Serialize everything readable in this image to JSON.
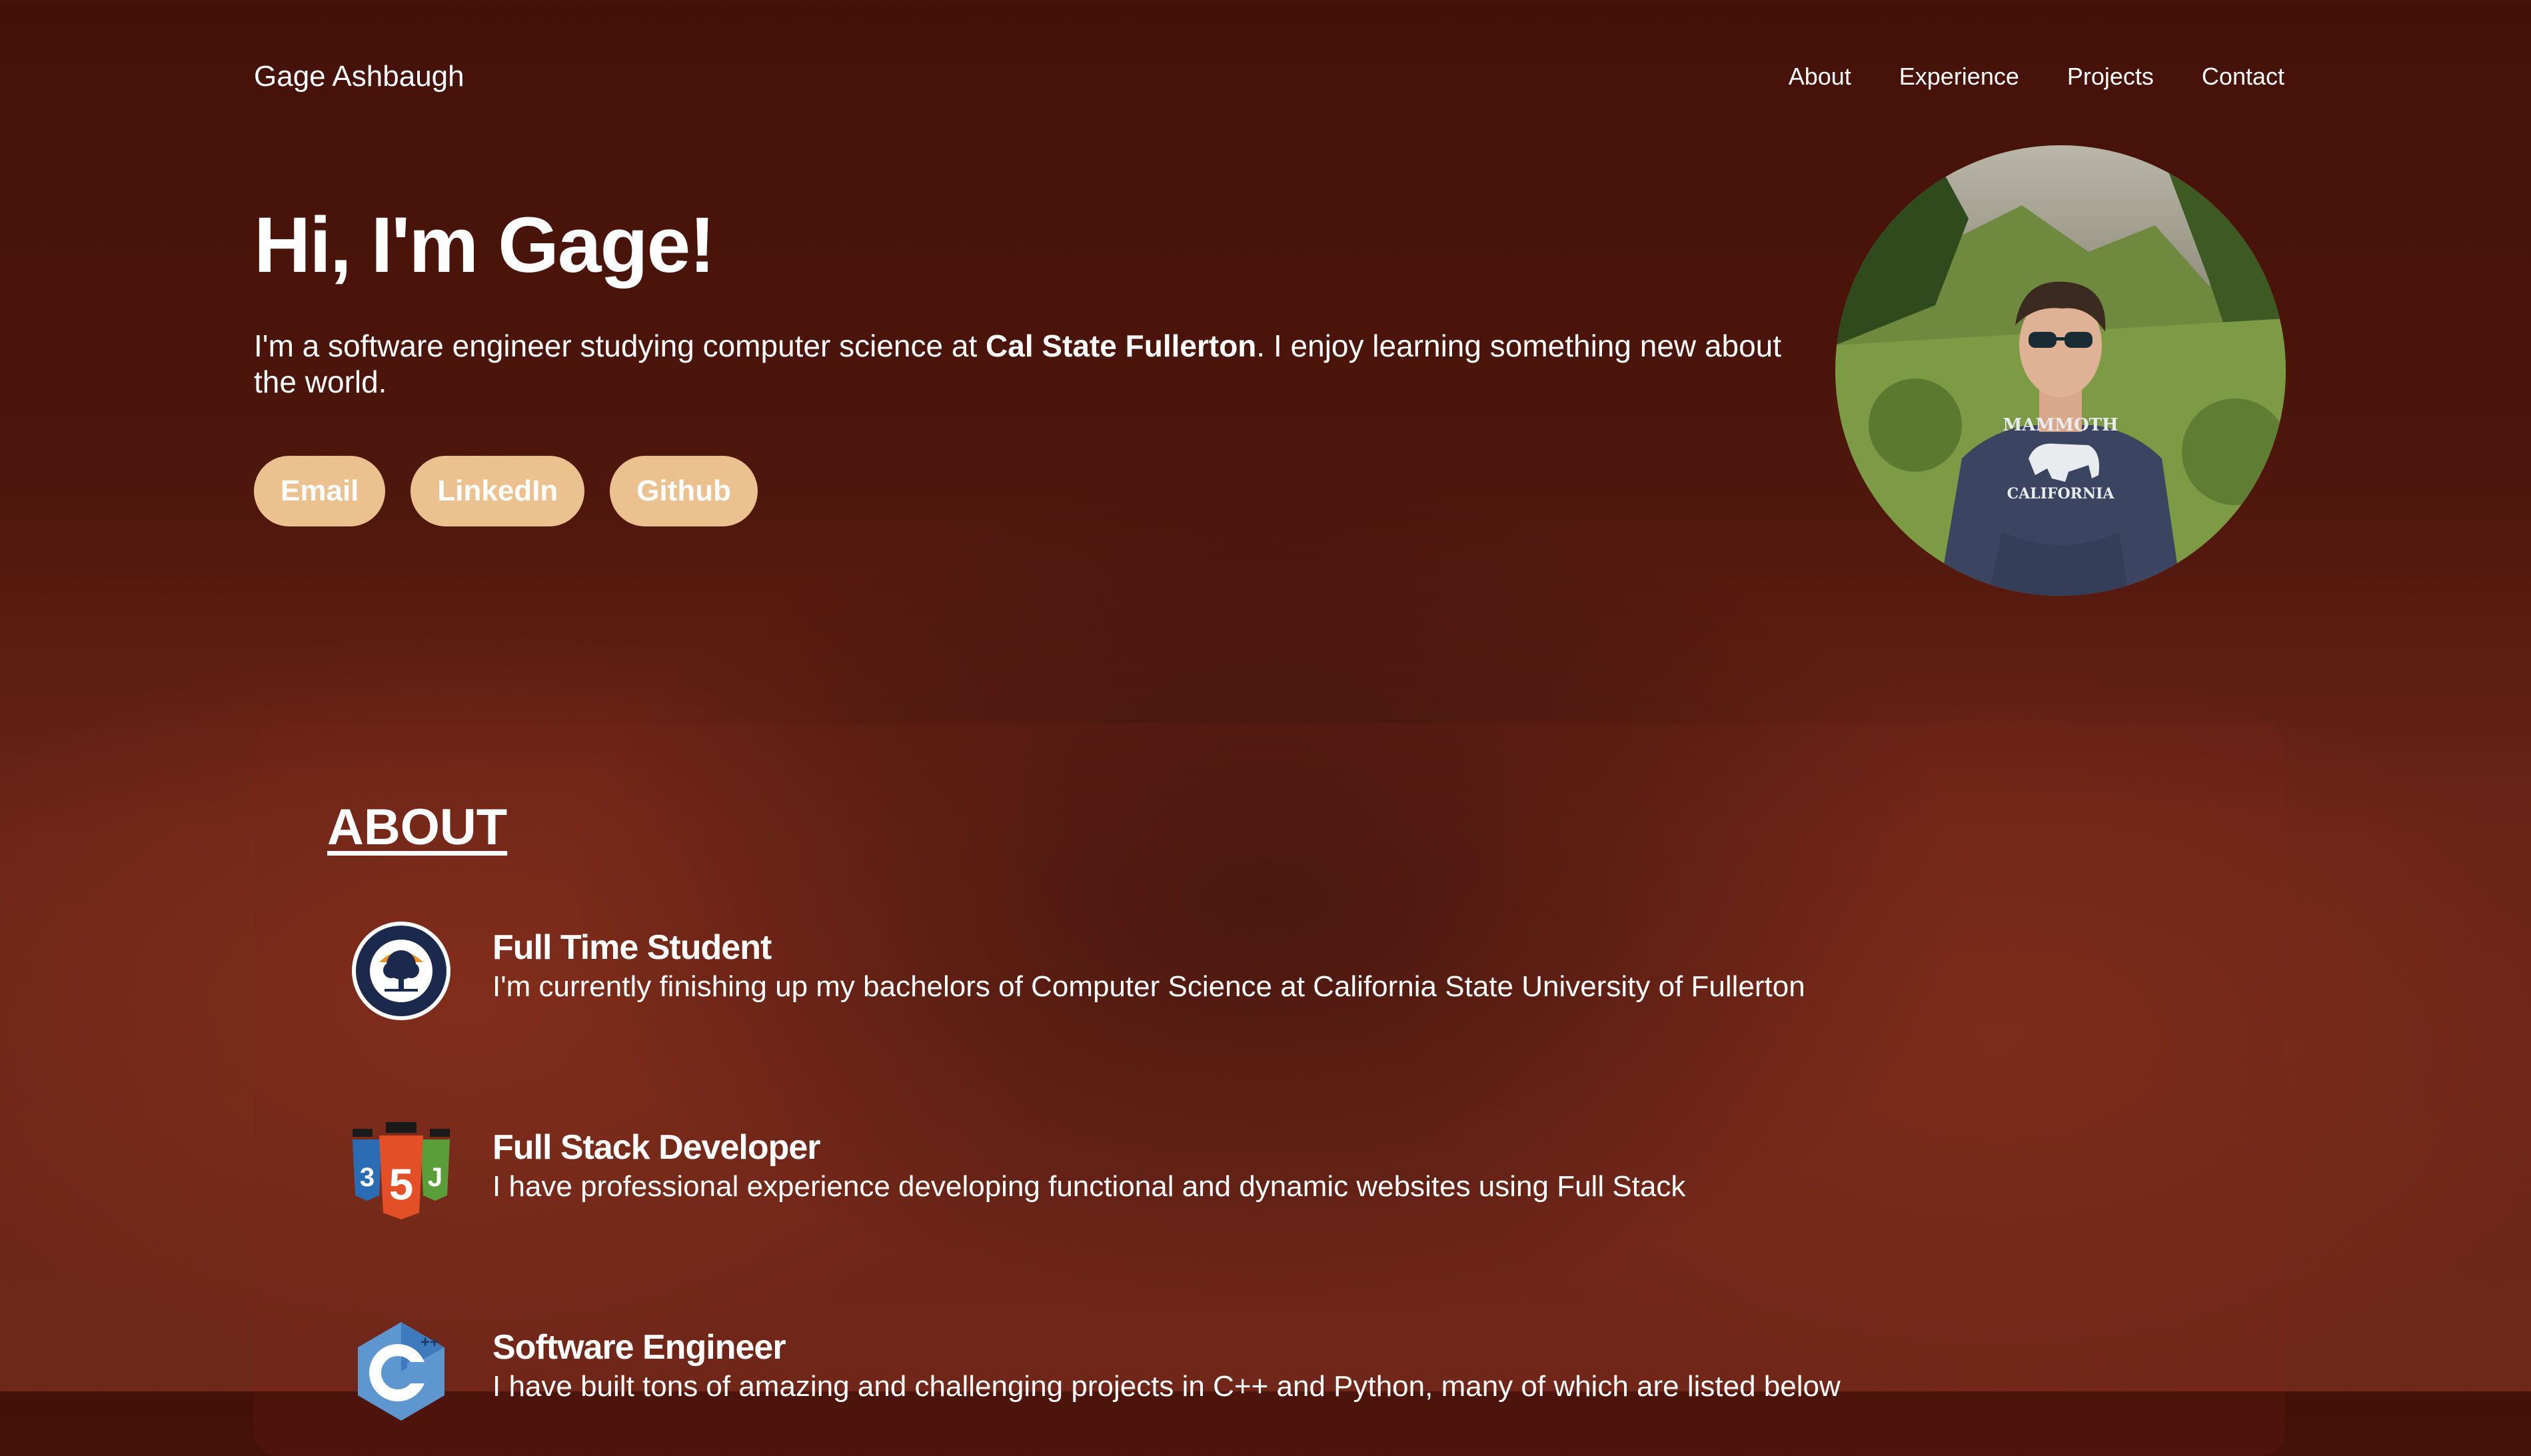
{
  "header": {
    "name": "Gage Ashbaugh",
    "nav": [
      "About",
      "Experience",
      "Projects",
      "Contact"
    ]
  },
  "hero": {
    "title": "Hi, I'm Gage!",
    "intro_before": "I'm a software engineer studying computer science at ",
    "intro_bold": "Cal State Fullerton",
    "intro_after": ". I enjoy learning something new about the world.",
    "buttons": [
      "Email",
      "LinkedIn",
      "Github"
    ],
    "photo_icon": "profile-photo"
  },
  "about": {
    "title": "ABOUT",
    "items": [
      {
        "icon": "university-seal-icon",
        "title": "Full Time Student",
        "text": "I'm currently finishing up my bachelors of Computer Science at California State University of Fullerton"
      },
      {
        "icon": "html-css-js-icon",
        "title": "Full Stack Developer",
        "text": "I have professional experience developing functional and dynamic websites using Full Stack"
      },
      {
        "icon": "cpp-icon",
        "title": "Software Engineer",
        "text": "I have built tons of amazing and challenging projects in C++ and Python, many of which are listed below"
      }
    ]
  },
  "colors": {
    "background_top": "#441109",
    "background_bottom": "#6e2819",
    "button": "#ecc190"
  }
}
